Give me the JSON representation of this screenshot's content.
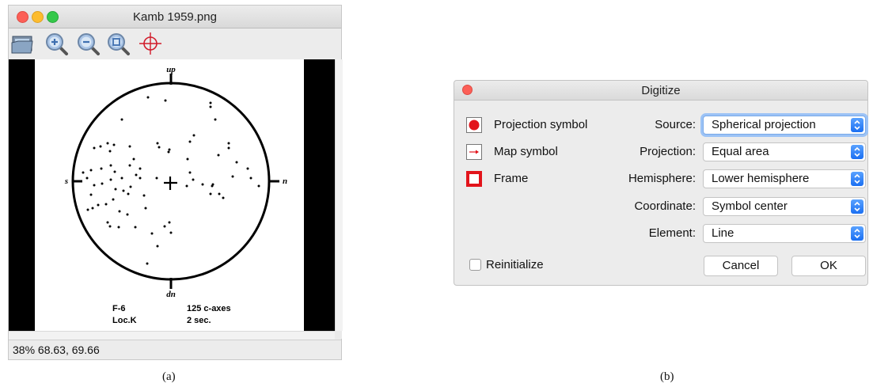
{
  "viewer": {
    "title": "Kamb 1959.png",
    "tools": [
      "open-image-icon",
      "zoom-in-icon",
      "zoom-out-icon",
      "zoom-fit-icon",
      "crosshair-icon"
    ],
    "image": {
      "top_label": "up",
      "bottom_label": "dn",
      "left_label": "s",
      "right_label": "n",
      "caption_left_1": "F-6",
      "caption_left_2": "Loc.K",
      "caption_right_1": "125 c-axes",
      "caption_right_2": "2 sec."
    },
    "status": "38%  68.63, 69.66",
    "caption": "(a)"
  },
  "dialog": {
    "title": "Digitize",
    "symbols": {
      "projection": "Projection symbol",
      "map": "Map symbol",
      "frame": "Frame"
    },
    "fields": {
      "source": {
        "label": "Source:",
        "value": "Spherical projection"
      },
      "projection": {
        "label": "Projection:",
        "value": "Equal area"
      },
      "hemisphere": {
        "label": "Hemisphere:",
        "value": "Lower hemisphere"
      },
      "coordinate": {
        "label": "Coordinate:",
        "value": "Symbol center"
      },
      "element": {
        "label": "Element:",
        "value": "Line"
      }
    },
    "reinitialize_label": "Reinitialize",
    "cancel_label": "Cancel",
    "ok_label": "OK",
    "caption": "(b)"
  },
  "colors": {
    "close": "#fc5f57",
    "minimize": "#fdbc2e",
    "zoom": "#34c84a",
    "accent": "#1a6ff2",
    "symbol_red": "#e2141b"
  }
}
